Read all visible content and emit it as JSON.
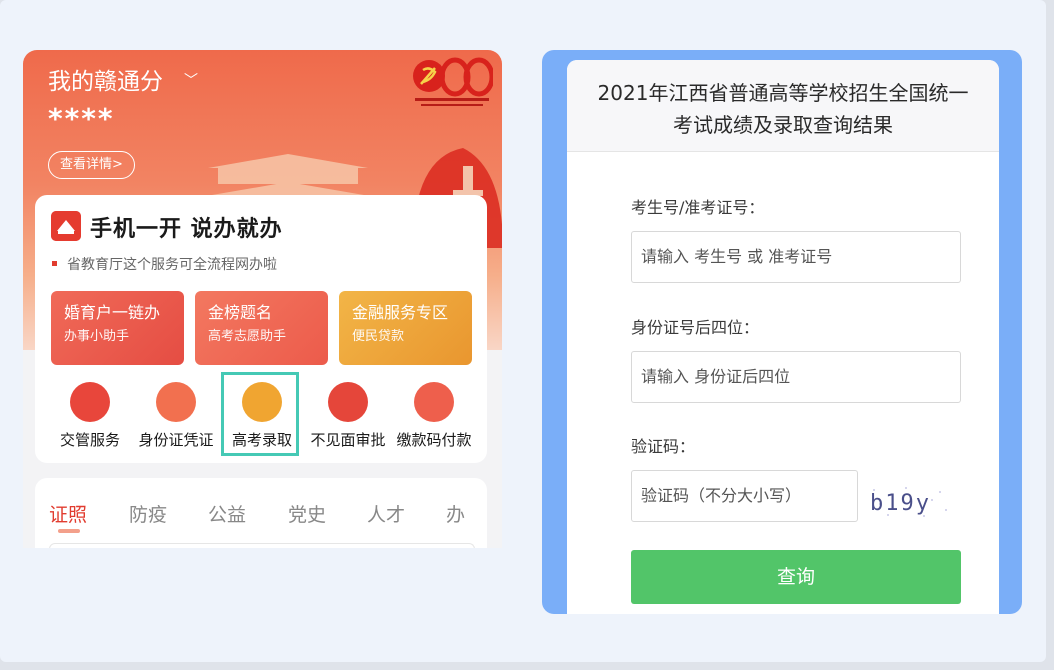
{
  "hero": {
    "title": "我的赣通分",
    "chevron": "﹀",
    "score_masked": "****",
    "detail_button": "查看详情>"
  },
  "service_card": {
    "title": "手机一开  说办就办",
    "subtitle": "省教育厅这个服务可全流程网办啦",
    "tiles": [
      {
        "title": "婚育户一链办",
        "subtitle": "办事小助手"
      },
      {
        "title": "金榜题名",
        "subtitle": "高考志愿助手"
      },
      {
        "title": "金融服务专区",
        "subtitle": "便民贷款"
      }
    ],
    "icons": [
      {
        "label": "交管服务",
        "color": "#e8463b"
      },
      {
        "label": "身份证凭证",
        "color": "#f2704f"
      },
      {
        "label": "高考录取",
        "color": "#f0a531"
      },
      {
        "label": "不见面审批",
        "color": "#e5463a"
      },
      {
        "label": "缴款码付款",
        "color": "#ee5f4c"
      }
    ]
  },
  "tabs": [
    "证照",
    "防疫",
    "公益",
    "党史",
    "人才",
    "办"
  ],
  "query_form": {
    "title_line1": "2021年江西省普通高等学校招生全国统一",
    "title_line2": "考试成绩及录取查询结果",
    "exam_label": "考生号/准考证号：",
    "exam_placeholder": "请输入 考生号 或 准考证号",
    "id_label": "身份证号后四位：",
    "id_placeholder": "请输入 身份证后四位",
    "captcha_label": "验证码：",
    "captcha_placeholder": "验证码（不分大小写）",
    "captcha_text": "b19y",
    "submit": "查询"
  },
  "colors": {
    "brand_red": "#e13c2f",
    "query_green": "#52c569",
    "panel_blue": "#7aaef8",
    "highlight": "#45c9b5"
  }
}
